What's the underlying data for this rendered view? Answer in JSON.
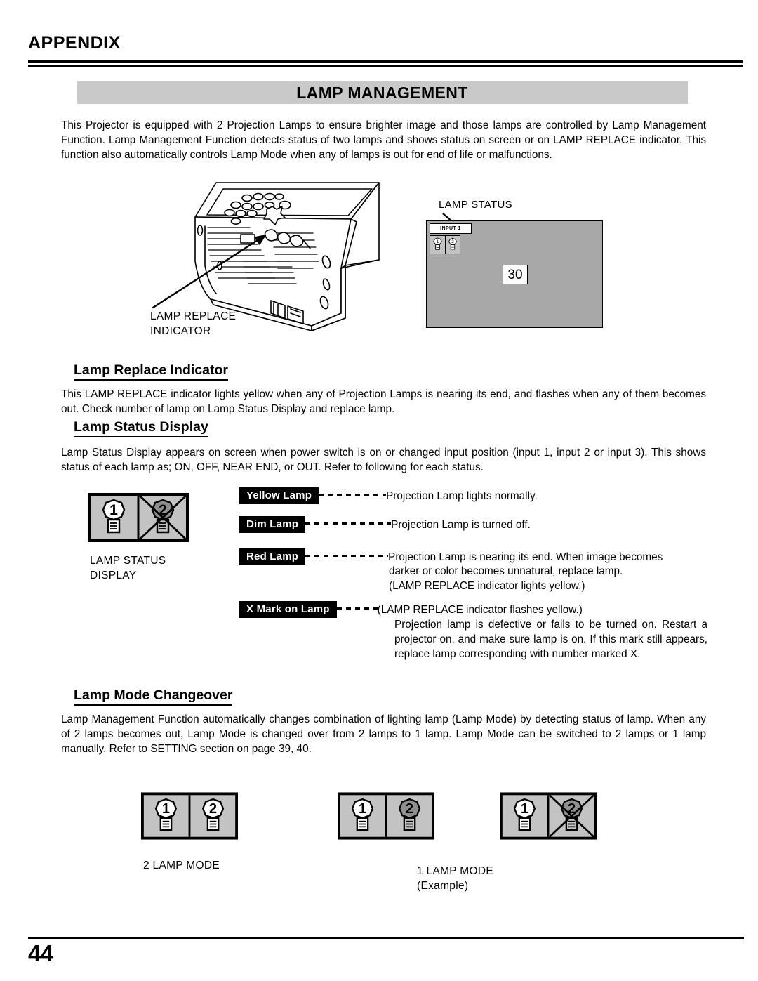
{
  "page": {
    "chapter_title": "APPENDIX",
    "section_title": "LAMP MANAGEMENT",
    "page_number": "44"
  },
  "intro": {
    "paragraph": "This Projector is equipped with 2 Projection Lamps to ensure brighter image and those lamps are controlled by Lamp Management Function.  Lamp Management Function detects status of two lamps and shows status on screen or on LAMP REPLACE indicator.  This function also automatically controls Lamp Mode when any of lamps is out for end of life or malfunctions."
  },
  "projector_figure": {
    "callout_label": "LAMP REPLACE\nINDICATOR"
  },
  "osd_figure": {
    "callout_label": "LAMP STATUS",
    "input_chip": "INPUT 1",
    "lamp_numbers": [
      "1",
      "2"
    ],
    "number_box": "30"
  },
  "sections": [
    {
      "heading": "Lamp Replace Indicator",
      "paragraph": "This LAMP REPLACE indicator lights yellow when any of Projection Lamps is nearing its end, and flashes when any of them becomes out.  Check number of lamp on Lamp Status Display and replace lamp."
    },
    {
      "heading": "Lamp Status Display",
      "paragraph": "Lamp Status Display appears on screen when power switch is on or changed input position (input 1, input 2 or input 3).  This shows status of each lamp as; ON, OFF, NEAR END, or OUT.  Refer to following for each status."
    },
    {
      "heading": "Lamp Mode Changeover",
      "paragraph": "Lamp Management Function automatically changes combination of lighting lamp (Lamp Mode) by detecting status of lamp. When any of 2 lamps becomes out, Lamp Mode is changed over from 2 lamps to 1 lamp. Lamp Mode can be switched to 2 lamps or 1 lamp manually.  Refer to SETTING section on page 39, 40."
    }
  ],
  "status_display_figure": {
    "caption": "LAMP STATUS\nDISPLAY",
    "lamps": [
      {
        "number": "1",
        "state": "on"
      },
      {
        "number": "2",
        "state": "x-mark"
      }
    ]
  },
  "legend": [
    {
      "tag": "Yellow Lamp",
      "text": "Projection Lamp lights normally.",
      "extra_lines": []
    },
    {
      "tag": "Dim Lamp",
      "text": "Projection Lamp is turned off.",
      "extra_lines": []
    },
    {
      "tag": "Red Lamp",
      "text": "Projection Lamp is nearing its end.  When image becomes",
      "extra_lines": [
        "darker or color becomes unnatural, replace lamp.",
        "(LAMP REPLACE indicator lights yellow.)"
      ]
    },
    {
      "tag": "X Mark on Lamp",
      "text": "(LAMP REPLACE indicator flashes yellow.)",
      "extra_lines": [
        "Projection lamp is defective or fails to be turned on. Restart a projector on, and make sure lamp is on. If this mark still appears, replace lamp corresponding with number marked X."
      ]
    }
  ],
  "lamp_modes": [
    {
      "name": "mode-2-lamp",
      "caption": "2 LAMP MODE",
      "lamps": [
        {
          "number": "1",
          "state": "on"
        },
        {
          "number": "2",
          "state": "on"
        }
      ]
    },
    {
      "name": "mode-1-lamp-dim",
      "caption": "",
      "lamps": [
        {
          "number": "1",
          "state": "on"
        },
        {
          "number": "2",
          "state": "dim"
        }
      ]
    },
    {
      "name": "mode-1-lamp-x",
      "caption": "",
      "lamps": [
        {
          "number": "1",
          "state": "on"
        },
        {
          "number": "2",
          "state": "x-mark"
        }
      ]
    }
  ],
  "lamp_mode_caption": "1 LAMP MODE\n(Example)",
  "colors": {
    "banner_gray": "#c9c9c9",
    "osd_gray": "#a8a8a8",
    "lamp_box_gray": "#c3c3c3",
    "lamp_dim_gray": "#8f8f8f",
    "lamp_on_white": "#ffffff",
    "ink": "#000000"
  }
}
